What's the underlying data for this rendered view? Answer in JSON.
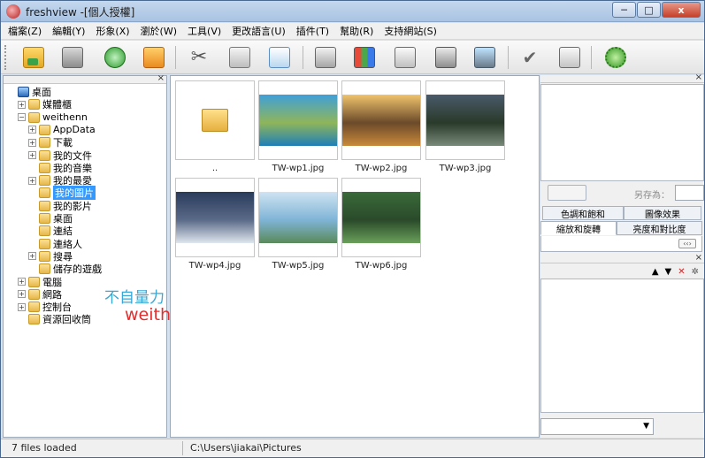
{
  "window": {
    "title": "freshview -[個人授權]"
  },
  "window_controls": {
    "minimize": "─",
    "maximize": "□",
    "close": "x"
  },
  "menu": [
    "檔案(Z)",
    "編輯(Y)",
    "形象(X)",
    "瀏於(W)",
    "工具(V)",
    "更改語言(U)",
    "插件(T)",
    "幫助(R)",
    "支持網站(S)"
  ],
  "toolbar": {
    "icons": [
      "folder-up-icon",
      "printer-icon",
      "refresh-icon",
      "home-folder-icon",
      "scissors-icon",
      "clipboard-icon",
      "copy-icon",
      "paste-icon",
      "thumbnail-view-icon",
      "document-stack-icon",
      "disk-icon",
      "scanner-icon",
      "check-icon",
      "mail-icon",
      "plugin-gear-icon"
    ]
  },
  "tree": {
    "items": [
      {
        "label": "桌面",
        "depth": 0,
        "toggle": "",
        "icon": "desktop-icon"
      },
      {
        "label": "媒體櫃",
        "depth": 1,
        "toggle": "+",
        "icon": "library-icon"
      },
      {
        "label": "weithenn",
        "depth": 1,
        "toggle": "-",
        "icon": "user-folder-icon"
      },
      {
        "label": "AppData",
        "depth": 2,
        "toggle": "+",
        "icon": "folder-icon"
      },
      {
        "label": "下載",
        "depth": 2,
        "toggle": "+",
        "icon": "download-folder-icon"
      },
      {
        "label": "我的文件",
        "depth": 2,
        "toggle": "+",
        "icon": "documents-folder-icon"
      },
      {
        "label": "我的音樂",
        "depth": 2,
        "toggle": "",
        "icon": "music-folder-icon"
      },
      {
        "label": "我的最愛",
        "depth": 2,
        "toggle": "+",
        "icon": "favorites-folder-icon"
      },
      {
        "label": "我的圖片",
        "depth": 2,
        "toggle": "",
        "icon": "pictures-folder-icon",
        "selected": true
      },
      {
        "label": "我的影片",
        "depth": 2,
        "toggle": "",
        "icon": "videos-folder-icon"
      },
      {
        "label": "桌面",
        "depth": 2,
        "toggle": "",
        "icon": "desktop-folder-icon"
      },
      {
        "label": "連結",
        "depth": 2,
        "toggle": "",
        "icon": "links-folder-icon"
      },
      {
        "label": "連絡人",
        "depth": 2,
        "toggle": "",
        "icon": "contacts-folder-icon"
      },
      {
        "label": "搜尋",
        "depth": 2,
        "toggle": "+",
        "icon": "search-folder-icon"
      },
      {
        "label": "儲存的遊戲",
        "depth": 2,
        "toggle": "",
        "icon": "games-folder-icon"
      },
      {
        "label": "電腦",
        "depth": 1,
        "toggle": "+",
        "icon": "computer-icon"
      },
      {
        "label": "網路",
        "depth": 1,
        "toggle": "+",
        "icon": "network-icon"
      },
      {
        "label": "控制台",
        "depth": 1,
        "toggle": "+",
        "icon": "control-panel-icon"
      },
      {
        "label": "資源回收筒",
        "depth": 1,
        "toggle": "",
        "icon": "recycle-bin-icon"
      }
    ]
  },
  "watermark": {
    "line1": "不自量力 の Weithenn",
    "line2": "weithenn.org"
  },
  "thumbnails": [
    {
      "caption": "..",
      "kind": "parent-folder"
    },
    {
      "caption": "TW-wp1.jpg",
      "kind": "photo",
      "colors": [
        "#3fa0d8",
        "#1e7fb8",
        "#8fb55a"
      ]
    },
    {
      "caption": "TW-wp2.jpg",
      "kind": "photo",
      "colors": [
        "#f1c46c",
        "#c98a3a",
        "#6b4a2a"
      ]
    },
    {
      "caption": "TW-wp3.jpg",
      "kind": "photo",
      "colors": [
        "#4a5a6a",
        "#7a8a7a",
        "#2a3a2a"
      ]
    },
    {
      "caption": "TW-wp4.jpg",
      "kind": "photo",
      "colors": [
        "#2a3a5a",
        "#dfe6ee",
        "#5a6a88"
      ]
    },
    {
      "caption": "TW-wp5.jpg",
      "kind": "photo",
      "colors": [
        "#cfe3f2",
        "#5a8a5a",
        "#7fb4d6"
      ]
    },
    {
      "caption": "TW-wp6.jpg",
      "kind": "photo",
      "colors": [
        "#3a6a3a",
        "#6aa05a",
        "#2a4a2a"
      ]
    }
  ],
  "right_panel": {
    "save_as_label": "另存為：",
    "tabs_row1": [
      "色調和飽和",
      "圖像效果"
    ],
    "tabs_row2": [
      "縮放和旋轉",
      "亮度和對比度"
    ],
    "active_tab": "縮放和旋轉",
    "mini_scroll": "‹‹›",
    "list_tools": [
      "up-arrow-icon",
      "down-arrow-icon",
      "delete-x-icon",
      "settings-sparkle-icon"
    ]
  },
  "status": {
    "files_loaded": "7 files loaded",
    "path": "C:\\Users\\jiakai\\Pictures"
  }
}
